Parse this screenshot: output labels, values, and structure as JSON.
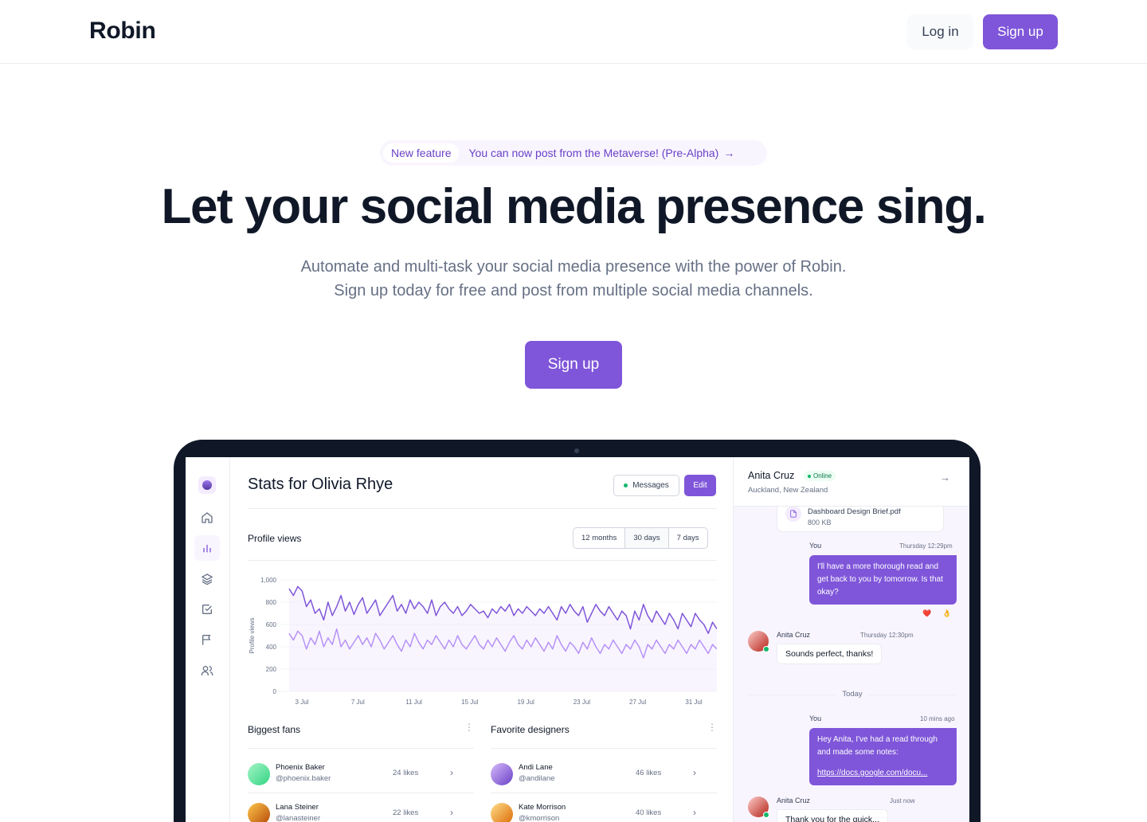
{
  "header": {
    "logo": "Robin",
    "login_label": "Log in",
    "signup_label": "Sign up"
  },
  "hero": {
    "badge_tag": "New feature",
    "badge_text": "You can now post from the Metaverse! (Pre-Alpha)",
    "badge_arrow": "→",
    "title": "Let your social media presence sing.",
    "subtitle_line1": "Automate and multi-task your social media presence with the power of Robin.",
    "subtitle_line2": "Sign up today for free and post from multiple social media channels.",
    "cta_label": "Sign up"
  },
  "app": {
    "sidebar": [
      "home-icon",
      "bar-chart-icon",
      "layers-icon",
      "check-square-icon",
      "flag-icon",
      "users-icon"
    ],
    "stats_title": "Stats for Olivia Rhye",
    "messages_label": "Messages",
    "edit_label": "Edit",
    "profile_views_title": "Profile views",
    "ranges": [
      "12 months",
      "30 days",
      "7 days"
    ],
    "biggest_fans_title": "Biggest fans",
    "favorite_designers_title": "Favorite designers",
    "fans": [
      {
        "name": "Phoenix Baker",
        "handle": "@phoenix.baker",
        "likes": "24 likes"
      },
      {
        "name": "Lana Steiner",
        "handle": "@lanasteiner",
        "likes": "22 likes"
      }
    ],
    "designers": [
      {
        "name": "Andi Lane",
        "handle": "@andilane",
        "likes": "46 likes"
      },
      {
        "name": "Kate Morrison",
        "handle": "@kmorrison",
        "likes": "40 likes"
      }
    ],
    "colors": {
      "primary": "#7f56d9",
      "secondary": "#b692f6"
    }
  },
  "chart_data": {
    "type": "line",
    "title": "",
    "xlabel": "",
    "ylabel": "Profile views",
    "ylim": [
      0,
      1000
    ],
    "yticks": [
      "0",
      "200",
      "400",
      "600",
      "800",
      "1,000"
    ],
    "xticks": [
      "3 Jul",
      "7 Jul",
      "11 Jul",
      "15 Jul",
      "19 Jul",
      "23 Jul",
      "27 Jul",
      "31 Jul"
    ],
    "series": [
      {
        "values": [
          920,
          860,
          940,
          900,
          760,
          820,
          700,
          740,
          640,
          800,
          680,
          760,
          860,
          720,
          800,
          690,
          780,
          840,
          700,
          760,
          820,
          680,
          740,
          800,
          860,
          720,
          780,
          700,
          820,
          740,
          800,
          760,
          700,
          820,
          680,
          760,
          800,
          740,
          700,
          760,
          680,
          720,
          780,
          740,
          700,
          720,
          660,
          740,
          700,
          760,
          720,
          780,
          680,
          740,
          700,
          760,
          720,
          680,
          740,
          700,
          760,
          700,
          640,
          760,
          700,
          780,
          720,
          680,
          760,
          620,
          700,
          780,
          720,
          680,
          760,
          700,
          640,
          720,
          680,
          560,
          720,
          640,
          780,
          680,
          620,
          720,
          660,
          600,
          700,
          640,
          560,
          700,
          640,
          580,
          700,
          640,
          600,
          520,
          620,
          560
        ]
      },
      {
        "values": [
          520,
          460,
          540,
          500,
          380,
          480,
          420,
          540,
          400,
          480,
          420,
          560,
          400,
          460,
          380,
          440,
          500,
          420,
          480,
          400,
          520,
          460,
          380,
          440,
          500,
          420,
          360,
          460,
          400,
          520,
          440,
          380,
          460,
          420,
          500,
          440,
          380,
          460,
          400,
          500,
          420,
          380,
          440,
          500,
          420,
          380,
          460,
          400,
          480,
          420,
          360,
          440,
          500,
          420,
          380,
          460,
          400,
          480,
          420,
          360,
          440,
          380,
          500,
          420,
          360,
          440,
          400,
          340,
          440,
          380,
          480,
          400,
          340,
          420,
          380,
          460,
          400,
          340,
          420,
          380,
          460,
          400,
          300,
          420,
          380,
          460,
          400,
          340,
          420,
          380,
          460,
          400,
          340,
          420,
          380,
          460,
          400,
          340,
          420,
          380
        ]
      }
    ],
    "grid": true,
    "legend": "none"
  },
  "chat": {
    "contact_name": "Anita Cruz",
    "status": "Online",
    "location": "Auckland, New Zealand",
    "arrow": "→",
    "file_name": "Dashboard Design Brief.pdf",
    "file_size": "800 KB",
    "msg1_sender": "You",
    "msg1_time": "Thursday 12:29pm",
    "msg1_text": "I'll have a more thorough read and get back to you by tomorrow. Is that okay?",
    "reactions": [
      "❤️",
      "👌"
    ],
    "msg2_sender": "Anita Cruz",
    "msg2_time": "Thursday 12:30pm",
    "msg2_text": "Sounds perfect, thanks!",
    "divider": "Today",
    "msg3_sender": "You",
    "msg3_time": "10 mins ago",
    "msg3_text": "Hey Anita, I've had a read through and made some notes:",
    "msg3_link": "https://docs.google.com/docu...",
    "msg4_sender": "Anita Cruz",
    "msg4_time": "Just now",
    "msg4_text": "Thank you for the quick..."
  }
}
